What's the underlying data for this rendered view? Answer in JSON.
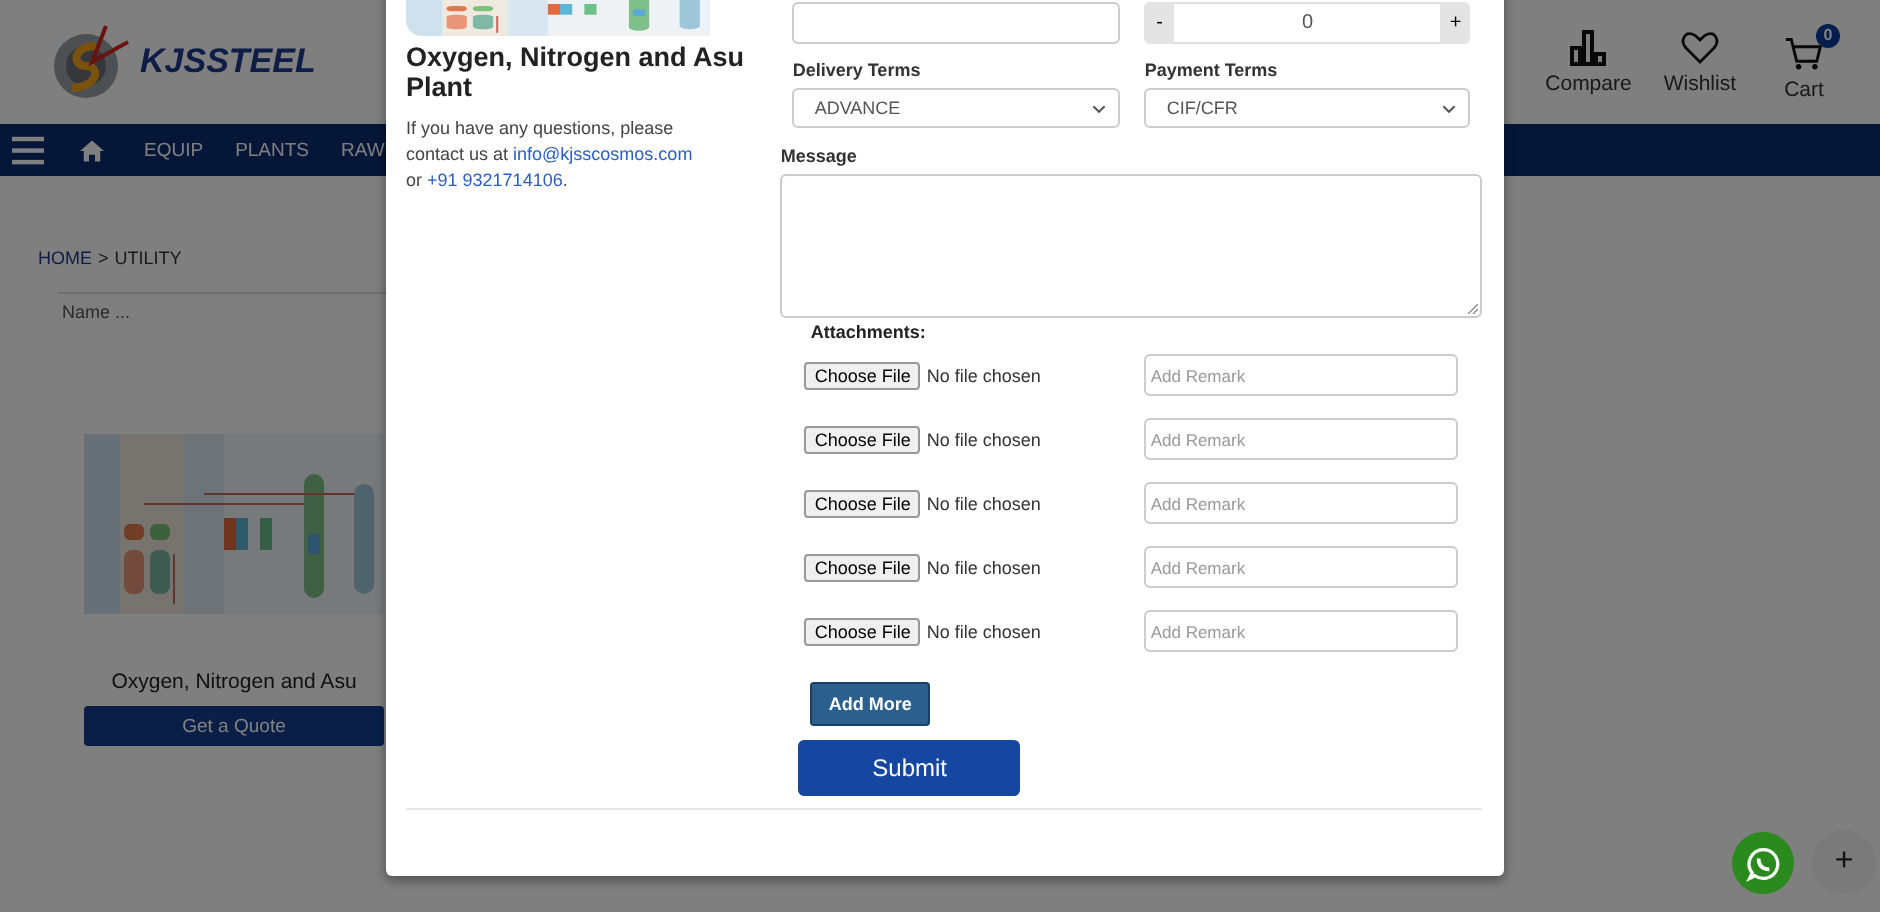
{
  "header": {
    "brand": "KJSSTEEL",
    "actions": [
      {
        "label": "Compare",
        "kind": "compare"
      },
      {
        "label": "Wishlist",
        "kind": "wishlist"
      },
      {
        "label": "Cart",
        "kind": "cart",
        "badge": "0"
      }
    ]
  },
  "nav": {
    "items": [
      "EQUIP",
      "PLANTS",
      "RAW"
    ]
  },
  "breadcrumb": {
    "items": [
      "HOME",
      "UTILITY"
    ],
    "separator": ">"
  },
  "search": {
    "placeholder": "Name ..."
  },
  "product": {
    "title": "Oxygen, Nitrogen and Asu",
    "button": "Get a Quote"
  },
  "modal": {
    "product_title": "Oxygen, Nitrogen and Asu Plant",
    "contact": {
      "before": "If you have any questions, please contact us at",
      "email": "info@kjsscosmos.com",
      "middle": "or",
      "phone": "+91 9321714106",
      "after": "."
    },
    "quantity": {
      "minus": "-",
      "value": "0",
      "plus": "+"
    },
    "delivery_terms": {
      "label": "Delivery Terms",
      "value": "ADVANCE"
    },
    "payment_terms": {
      "label": "Payment Terms",
      "value": "CIF/CFR"
    },
    "message": {
      "label": "Message"
    },
    "attachments": {
      "label": "Attachments:",
      "rows": [
        {
          "button": "Choose File",
          "status": "No file chosen",
          "remark_placeholder": "Add Remark"
        },
        {
          "button": "Choose File",
          "status": "No file chosen",
          "remark_placeholder": "Add Remark"
        },
        {
          "button": "Choose File",
          "status": "No file chosen",
          "remark_placeholder": "Add Remark"
        },
        {
          "button": "Choose File",
          "status": "No file chosen",
          "remark_placeholder": "Add Remark"
        },
        {
          "button": "Choose File",
          "status": "No file chosen",
          "remark_placeholder": "Add Remark"
        }
      ]
    },
    "add_more": "Add More",
    "submit": "Submit"
  },
  "floating": {
    "plus": "+"
  }
}
